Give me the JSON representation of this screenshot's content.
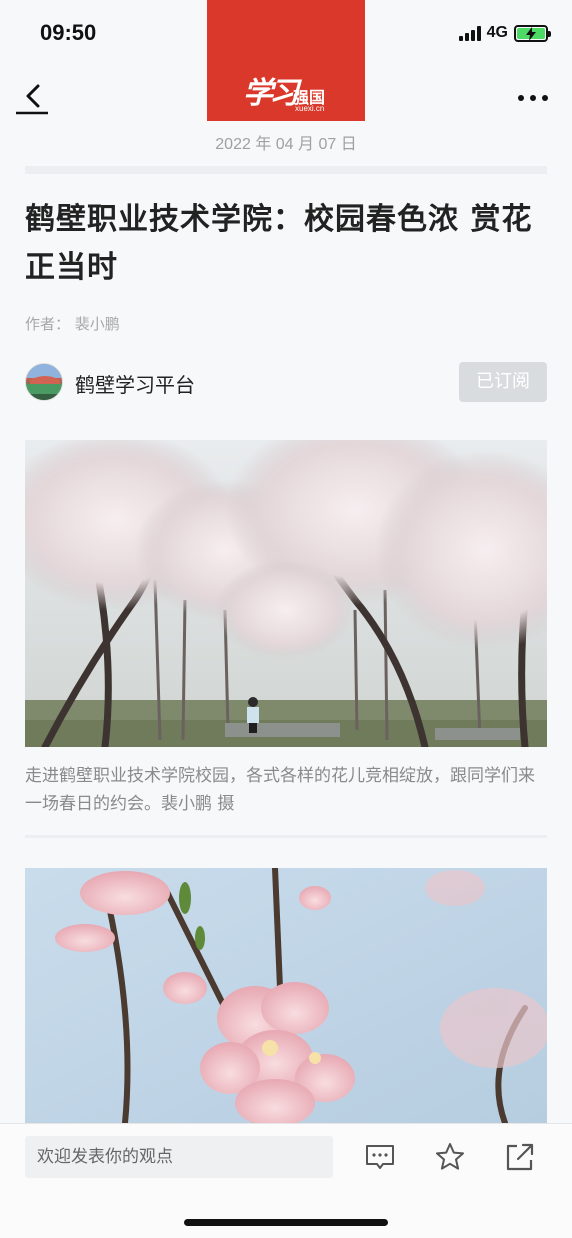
{
  "status_bar": {
    "time": "09:50",
    "network": "4G",
    "battery_percent": 100
  },
  "header": {
    "logo_text": "学习",
    "logo_sub": "强国",
    "logo_url": "xuexi.cn",
    "date": "2022 年 04 月 07 日"
  },
  "article": {
    "title": "鹤壁职业技术学院：校园春色浓  赏花正当时",
    "author": "作者：  裴小鹏",
    "source_name": "鹤壁学习平台",
    "subscribe_label": "已订阅",
    "caption": "走进鹤壁职业技术学院校园，各式各样的花儿竞相绽放，跟同学们来一场春日的约会。裴小鹏 摄"
  },
  "bottom_bar": {
    "comment_placeholder": "欢迎发表你的观点",
    "icons": [
      "comment-icon",
      "star-icon",
      "share-icon"
    ]
  },
  "colors": {
    "brand_red": "#d9382a",
    "muted_text": "#8a8a8a",
    "battery_green": "#4cd964"
  }
}
